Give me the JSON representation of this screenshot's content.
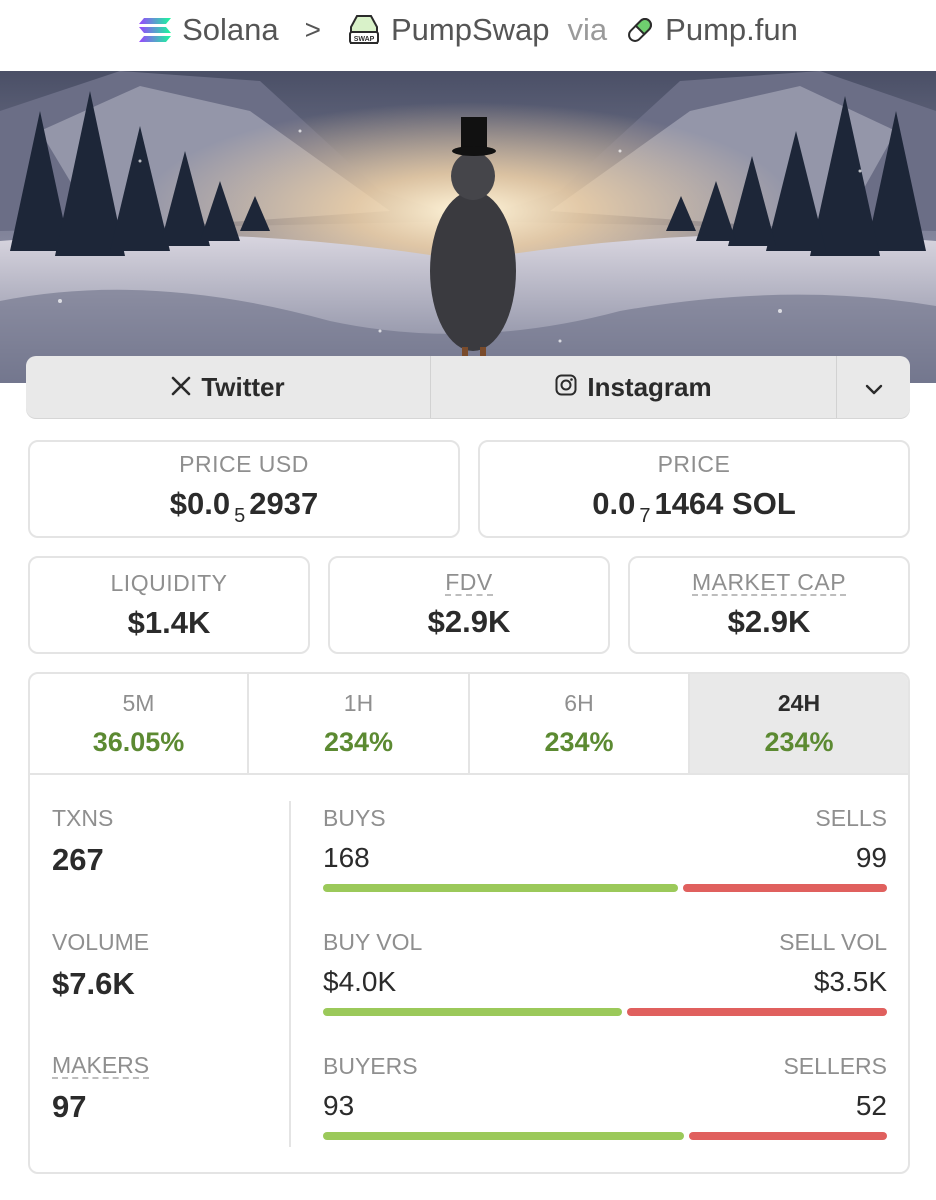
{
  "breadcrumb": {
    "chain": "Solana",
    "separator": ">",
    "dex": "PumpSwap",
    "dex_badge": "SWAP",
    "via": "via",
    "launchpad": "Pump.fun"
  },
  "social": {
    "twitter_label": "Twitter",
    "instagram_label": "Instagram"
  },
  "price": {
    "usd_label": "PRICE USD",
    "usd_prefix": "$0.0",
    "usd_zeros": "5",
    "usd_digits": "2937",
    "native_label": "PRICE",
    "native_prefix": "0.0",
    "native_zeros": "7",
    "native_digits": "1464 SOL"
  },
  "metrics": {
    "liquidity_label": "LIQUIDITY",
    "liquidity_value": "$1.4K",
    "fdv_label": "FDV",
    "fdv_value": "$2.9K",
    "mcap_label": "MARKET CAP",
    "mcap_value": "$2.9K"
  },
  "timeframes": [
    {
      "label": "5M",
      "change": "36.05%"
    },
    {
      "label": "1H",
      "change": "234%"
    },
    {
      "label": "6H",
      "change": "234%"
    },
    {
      "label": "24H",
      "change": "234%",
      "active": true
    }
  ],
  "stats": {
    "txns_label": "TXNS",
    "txns_value": "267",
    "volume_label": "VOLUME",
    "volume_value": "$7.6K",
    "makers_label": "MAKERS",
    "makers_value": "97",
    "rows": [
      {
        "left_label": "BUYS",
        "right_label": "SELLS",
        "left_value": "168",
        "right_value": "99",
        "buy_fraction": 0.63
      },
      {
        "left_label": "BUY VOL",
        "right_label": "SELL VOL",
        "left_value": "$4.0K",
        "right_value": "$3.5K",
        "buy_fraction": 0.53
      },
      {
        "left_label": "BUYERS",
        "right_label": "SELLERS",
        "left_value": "93",
        "right_value": "52",
        "buy_fraction": 0.64
      }
    ]
  },
  "colors": {
    "positive": "#5c8a32",
    "buy_bar": "#9bc95a",
    "sell_bar": "#e0605e",
    "active_tab_bg": "#e9e9e9"
  }
}
